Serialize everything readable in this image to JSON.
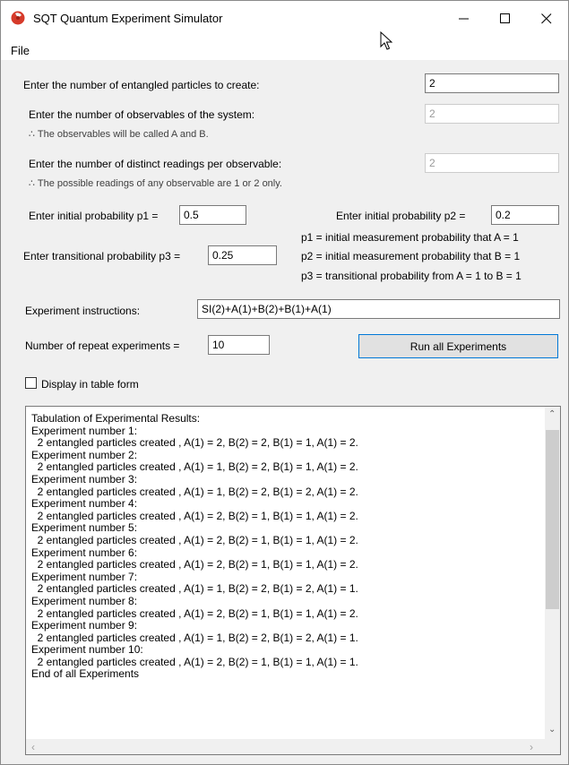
{
  "window": {
    "title": "SQT Quantum Experiment Simulator"
  },
  "menu": {
    "file": "File"
  },
  "form": {
    "particles_label": "Enter the number of entangled particles to create:",
    "particles_value": "2",
    "observables_label": "Enter the number of observables of the system:",
    "observables_value": "2",
    "observables_note": "∴ The observables will be called A and B.",
    "readings_label": "Enter the number of distinct readings per observable:",
    "readings_value": "2",
    "readings_note": "∴ The possible readings of any observable are 1 or 2 only.",
    "p1_label": "Enter initial probability p1 =",
    "p1_value": "0.5",
    "p2_label": "Enter initial probability p2 =",
    "p2_value": "0.2",
    "p3_label": "Enter transitional probability p3 =",
    "p3_value": "0.25",
    "p1_desc": "p1 = initial measurement probability that A = 1",
    "p2_desc": "p2 = initial measurement probability that B = 1",
    "p3_desc": "p3 = transitional probability from A = 1 to B = 1",
    "instructions_label": "Experiment instructions:",
    "instructions_value": "SI(2)+A(1)+B(2)+B(1)+A(1)",
    "repeat_label": "Number of repeat experiments =",
    "repeat_value": "10",
    "run_button": "Run all Experiments",
    "table_form_label": "Display in table form"
  },
  "results": {
    "lines": [
      "Tabulation of Experimental Results:",
      "Experiment number 1:",
      "  2 entangled particles created , A(1) = 2, B(2) = 2, B(1) = 1, A(1) = 2.",
      "Experiment number 2:",
      "  2 entangled particles created , A(1) = 1, B(2) = 2, B(1) = 1, A(1) = 2.",
      "Experiment number 3:",
      "  2 entangled particles created , A(1) = 1, B(2) = 2, B(1) = 2, A(1) = 2.",
      "Experiment number 4:",
      "  2 entangled particles created , A(1) = 2, B(2) = 1, B(1) = 1, A(1) = 2.",
      "Experiment number 5:",
      "  2 entangled particles created , A(1) = 2, B(2) = 1, B(1) = 1, A(1) = 2.",
      "Experiment number 6:",
      "  2 entangled particles created , A(1) = 2, B(2) = 1, B(1) = 1, A(1) = 2.",
      "Experiment number 7:",
      "  2 entangled particles created , A(1) = 1, B(2) = 2, B(1) = 2, A(1) = 1.",
      "Experiment number 8:",
      "  2 entangled particles created , A(1) = 2, B(2) = 1, B(1) = 1, A(1) = 2.",
      "Experiment number 9:",
      "  2 entangled particles created , A(1) = 1, B(2) = 2, B(1) = 2, A(1) = 1.",
      "Experiment number 10:",
      "  2 entangled particles created , A(1) = 2, B(2) = 1, B(1) = 1, A(1) = 1.",
      "End of all Experiments"
    ]
  },
  "icons": {
    "app": "red-sphere-app-icon",
    "minimize": "minimize-icon",
    "maximize": "maximize-icon",
    "close": "close-icon",
    "cursor": "mouse-pointer-icon"
  },
  "colors": {
    "accent_border": "#0078d7",
    "app_icon": "#d63a2a"
  }
}
